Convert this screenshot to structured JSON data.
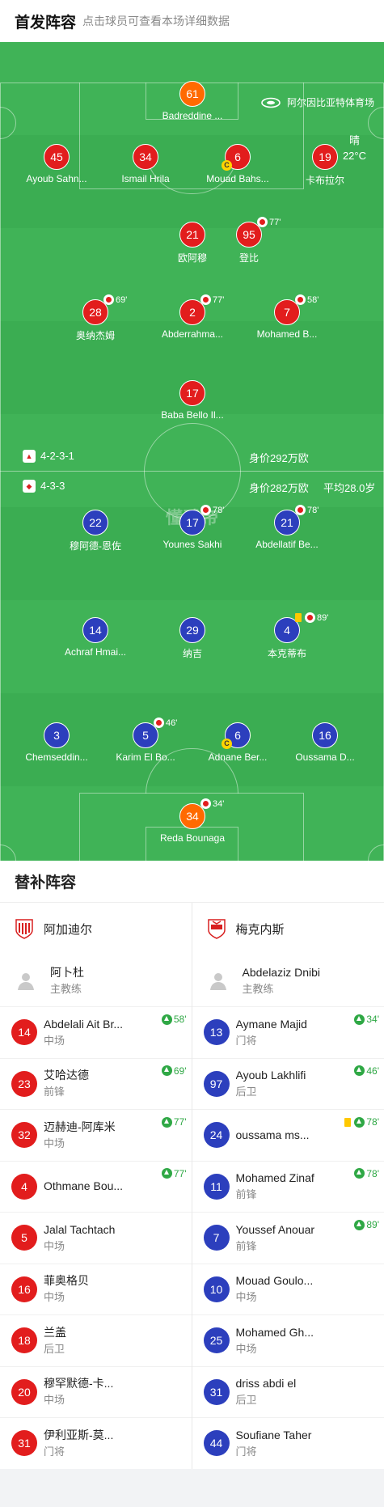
{
  "header": {
    "title": "首发阵容",
    "subtitle": "点击球员可查看本场详细数据"
  },
  "pitch": {
    "venue": "阿尔因比亚特体育场",
    "weather": "晴",
    "temperature": "22°C",
    "watermark": "懂球帝",
    "home": {
      "formation": "4-2-3-1",
      "value": "身价292万欧"
    },
    "away": {
      "formation": "4-3-3",
      "value": "身价282万欧",
      "avg_age": "平均28.0岁"
    },
    "players": [
      {
        "num": "61",
        "name": "Badreddine ...",
        "color": "org"
      },
      {
        "num": "45",
        "name": "Ayoub Sahn...",
        "color": "red"
      },
      {
        "num": "34",
        "name": "Ismail Hrila",
        "color": "red"
      },
      {
        "num": "6",
        "name": "Mouad Bahs...",
        "color": "red",
        "captain": "C"
      },
      {
        "num": "19",
        "name": "卡布拉尔",
        "color": "red"
      },
      {
        "num": "21",
        "name": "欧阿穆",
        "color": "red"
      },
      {
        "num": "95",
        "name": "登比",
        "color": "red",
        "sub": "77'"
      },
      {
        "num": "28",
        "name": "奥纳杰姆",
        "color": "red",
        "sub": "69'"
      },
      {
        "num": "2",
        "name": "Abderrahma...",
        "color": "red",
        "sub": "77'"
      },
      {
        "num": "7",
        "name": "Mohamed B...",
        "color": "red",
        "sub": "58'"
      },
      {
        "num": "17",
        "name": "Baba Bello Il...",
        "color": "red"
      },
      {
        "num": "22",
        "name": "穆阿德-恩佐",
        "color": "blue"
      },
      {
        "num": "17",
        "name": "Younes Sakhi",
        "color": "blue",
        "sub": "78'"
      },
      {
        "num": "21",
        "name": "Abdellatif Be...",
        "color": "blue",
        "sub": "78'"
      },
      {
        "num": "14",
        "name": "Achraf Hmai...",
        "color": "blue"
      },
      {
        "num": "29",
        "name": "纳吉",
        "color": "blue"
      },
      {
        "num": "4",
        "name": "本克蒂布",
        "color": "blue",
        "sub": "89'",
        "yellow": true
      },
      {
        "num": "3",
        "name": "Chemseddin...",
        "color": "blue"
      },
      {
        "num": "5",
        "name": "Karim El Bo...",
        "color": "blue",
        "sub": "46'"
      },
      {
        "num": "6",
        "name": "Adnane Ber...",
        "color": "blue",
        "captain": "C"
      },
      {
        "num": "16",
        "name": "Oussama D...",
        "color": "blue"
      },
      {
        "num": "34",
        "name": "Reda Bounaga",
        "color": "org",
        "sub": "34'"
      }
    ]
  },
  "subs": {
    "title": "替补阵容",
    "home": {
      "team": "阿加迪尔",
      "coach": {
        "name": "阿卜杜",
        "role": "主教练"
      },
      "players": [
        {
          "num": "14",
          "name": "Abdelali Ait Br...",
          "pos": "中场",
          "in": "58'"
        },
        {
          "num": "23",
          "name": "艾哈达德",
          "pos": "前锋",
          "in": "69'"
        },
        {
          "num": "32",
          "name": "迈赫迪-阿库米",
          "pos": "中场",
          "in": "77'"
        },
        {
          "num": "4",
          "name": "Othmane Bou...",
          "pos": "",
          "in": "77'"
        },
        {
          "num": "5",
          "name": "Jalal Tachtach",
          "pos": "中场"
        },
        {
          "num": "16",
          "name": "菲奥格贝",
          "pos": "中场"
        },
        {
          "num": "18",
          "name": "兰盖",
          "pos": "后卫"
        },
        {
          "num": "20",
          "name": "穆罕默德-卡...",
          "pos": "中场"
        },
        {
          "num": "31",
          "name": "伊利亚斯-莫...",
          "pos": "门将"
        }
      ]
    },
    "away": {
      "team": "梅克内斯",
      "coach": {
        "name": "Abdelaziz Dnibi",
        "role": "主教练"
      },
      "players": [
        {
          "num": "13",
          "name": "Aymane Majid",
          "pos": "门将",
          "in": "34'"
        },
        {
          "num": "97",
          "name": "Ayoub Lakhlifi",
          "pos": "后卫",
          "in": "46'"
        },
        {
          "num": "24",
          "name": "oussama ms...",
          "pos": "",
          "in": "78'",
          "yellow": true
        },
        {
          "num": "11",
          "name": "Mohamed Zinaf",
          "pos": "前锋",
          "in": "78'"
        },
        {
          "num": "7",
          "name": "Youssef Anouar",
          "pos": "前锋",
          "in": "89'"
        },
        {
          "num": "10",
          "name": "Mouad Goulo...",
          "pos": "中场"
        },
        {
          "num": "25",
          "name": "Mohamed Gh...",
          "pos": "中场"
        },
        {
          "num": "31",
          "name": "driss abdi el",
          "pos": "后卫"
        },
        {
          "num": "44",
          "name": "Soufiane Taher",
          "pos": "门将"
        }
      ]
    }
  }
}
